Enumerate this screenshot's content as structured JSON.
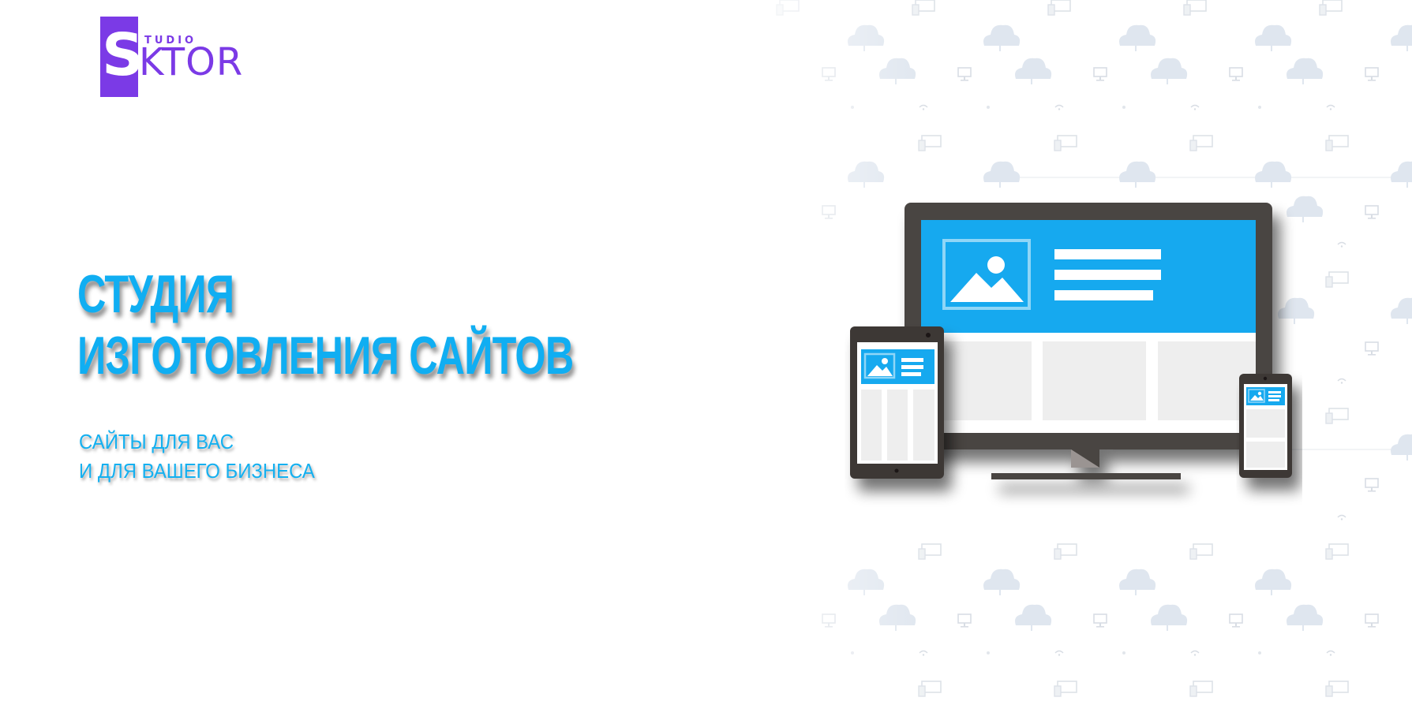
{
  "logo": {
    "letter": "S",
    "studio": "TUDIO",
    "name": "KTOR"
  },
  "hero": {
    "title_line1": "СТУДИЯ",
    "title_line2": "ИЗГОТОВЛЕНИЯ САЙТОВ",
    "subtitle_line1": "САЙТЫ ДЛЯ ВАС",
    "subtitle_line2": "И ДЛЯ ВАШЕГО БИЗНЕСА"
  },
  "colors": {
    "accent_blue": "#10aef2",
    "logo_purple": "#7b3ae6",
    "device_frame": "#4a4543",
    "screen_blue": "#16a9ef",
    "placeholder_gray": "#eeeeee"
  },
  "icons": {
    "background_pattern": [
      "cloud-icon",
      "monitor-icon",
      "devices-icon",
      "wifi-icon"
    ],
    "illustration": [
      "desktop-monitor-icon",
      "tablet-icon",
      "smartphone-icon",
      "image-placeholder-icon"
    ]
  }
}
